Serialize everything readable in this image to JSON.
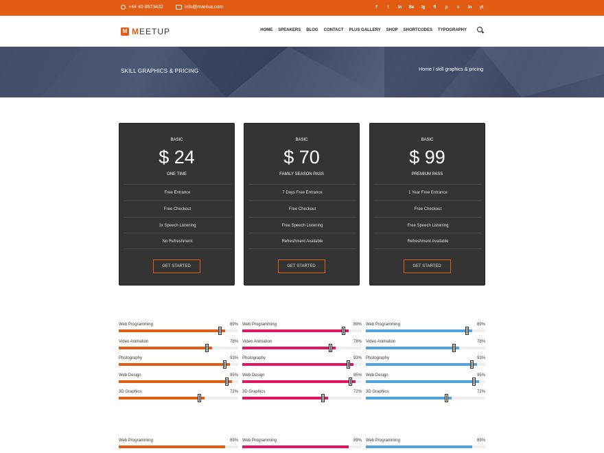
{
  "topbar": {
    "phone": "+44 40 8873432",
    "email": "info@maniva.com",
    "socials": [
      "f",
      "t",
      "in",
      "Be",
      "ig",
      "fl",
      "p",
      "v",
      "in",
      "yt"
    ]
  },
  "header": {
    "logo_mark": "M",
    "logo_first": "M",
    "logo_rest": "EETUP",
    "nav": [
      "HOME",
      "SPEAKERS",
      "BLOG",
      "CONTACT",
      "PLUS GALLERY",
      "SHOP",
      "SHORTCODES",
      "TYPOGRAPHY"
    ]
  },
  "banner": {
    "title": "SKILL GRAPHICS & PRICING",
    "breadcrumb": "Home / skill graphics & pricing"
  },
  "pricing": [
    {
      "plan": "BASIC",
      "price": "$ 24",
      "subtitle": "ONE TIME",
      "features": [
        "Free Entrance",
        "Free Checkout",
        "1x Speech Listening",
        "No Refreshment"
      ],
      "button": "GET STARTED"
    },
    {
      "plan": "BASIC",
      "price": "$ 70",
      "subtitle": "FAMILY SEASON PASS",
      "features": [
        "7 Days Free Entrance",
        "Free Checkout",
        "Free Speech Listening",
        "Refreshment Available"
      ],
      "button": "GET STARTED"
    },
    {
      "plan": "BASIC",
      "price": "$ 99",
      "subtitle": "PREMIUM PASS",
      "features": [
        "1 Year Free Entrance",
        "Free Checkout",
        "Free Speech Listening",
        "Refreshment Available"
      ],
      "button": "GET STARTED"
    }
  ],
  "skills": {
    "colors": [
      "#e35c13",
      "#e3145f",
      "#4fa3e3"
    ],
    "items": [
      {
        "label": "Web Programming",
        "percent_text": "89%",
        "value": 89
      },
      {
        "label": "Video Animation",
        "percent_text": "78%",
        "value": 78
      },
      {
        "label": "Photography",
        "percent_text": "93%",
        "value": 93
      },
      {
        "label": "Web Design",
        "percent_text": "95%",
        "value": 95
      },
      {
        "label": "3D Graphics",
        "percent_text": "72%",
        "value": 72
      }
    ],
    "bottom_row": {
      "label": "Web Programming",
      "percent_text": "89%",
      "value": 89
    }
  }
}
